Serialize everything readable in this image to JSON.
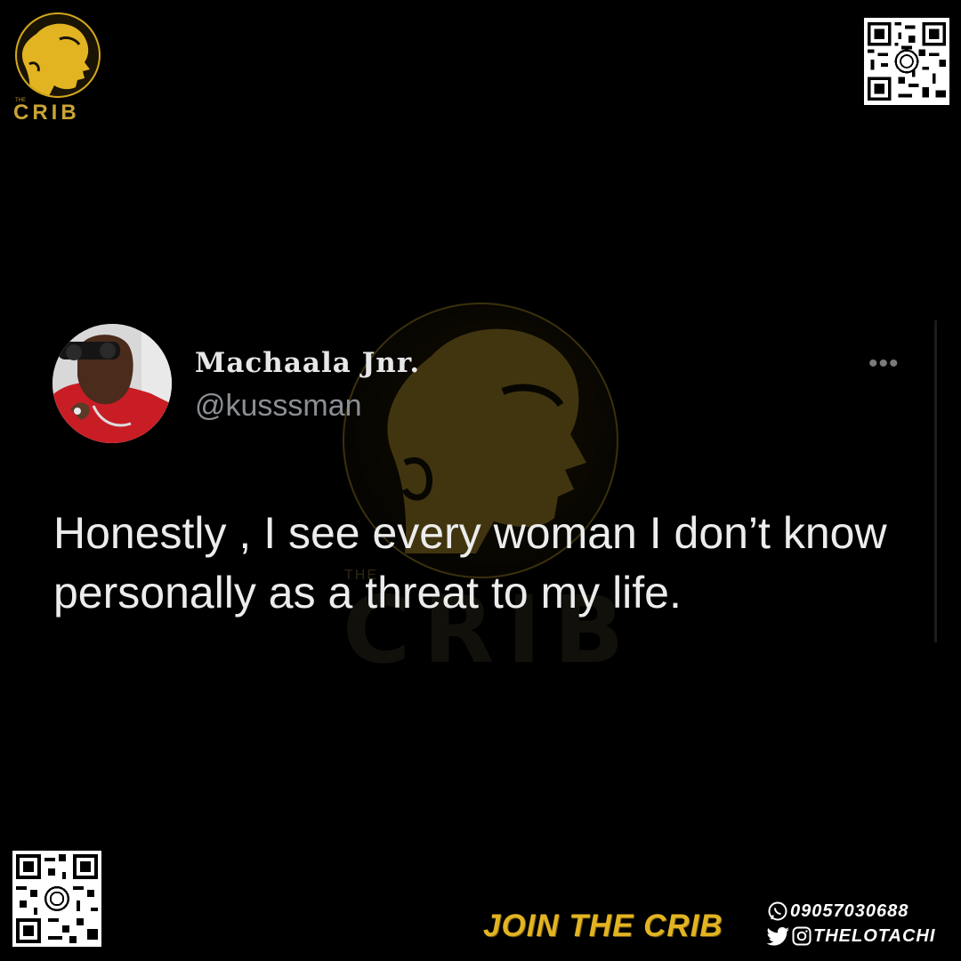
{
  "brand": {
    "logo_the": "THE",
    "logo_name": "CRIB",
    "watermark_the": "THE",
    "watermark_name": "CRIB"
  },
  "tweet": {
    "display_name": "Machaala Jnr.",
    "handle": "@kusssman",
    "more_label": "•••",
    "text": "Honestly , I see every woman I don’t know personally as a threat to my life."
  },
  "footer": {
    "cta": "JOIN THE CRIB",
    "phone": "09057030688",
    "social": "THELOTACHI",
    "icons": [
      "whatsapp-icon",
      "twitter-icon",
      "instagram-icon"
    ]
  },
  "colors": {
    "background": "#000000",
    "accent": "#e3b422",
    "text": "#ececec",
    "muted": "#8b8f93"
  }
}
